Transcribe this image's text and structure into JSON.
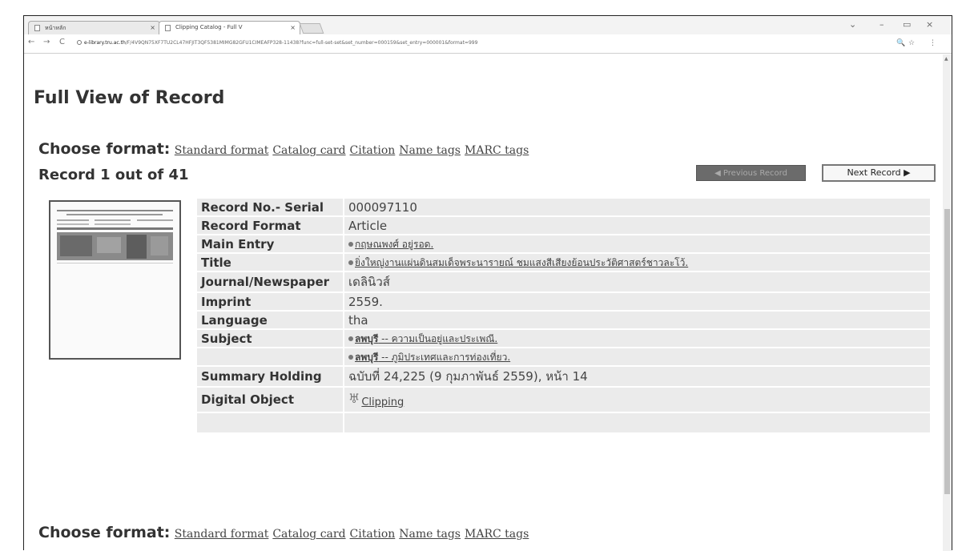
{
  "browser": {
    "tabs": [
      {
        "label": "หน้าหลัก",
        "close": "×"
      },
      {
        "label": "Clipping Catalog - Full V",
        "close": "×"
      }
    ],
    "window_controls": [
      "⌄",
      "–",
      "▭",
      "×"
    ],
    "nav": {
      "back": "←",
      "forward": "→",
      "reload": "C"
    },
    "url_host": "e-library.tru.ac.th",
    "url_path": "/F/4V9QN75XF7TU2CL47HFJIT3QF5381MIMG82GFU1CIMEAFP328-11438?func=full-set-set&set_number=000159&set_entry=000001&format=999",
    "addr_icons": [
      "🔍",
      "☆",
      "⋮"
    ]
  },
  "page": {
    "title": "Full View of Record",
    "choose_format_label": "Choose format:",
    "formats": [
      "Standard format",
      "Catalog card",
      "Citation",
      "Name tags",
      "MARC tags"
    ],
    "record_count": "Record 1 out of 41",
    "prev_button": "◀ Previous Record",
    "next_button": "Next Record ▶"
  },
  "record": [
    {
      "label": "Record No.- Serial",
      "value": "000097110"
    },
    {
      "label": "Record Format",
      "value": "Article"
    },
    {
      "label": "Main Entry",
      "value": "กฤษณพงศ์ อยู่รอด."
    },
    {
      "label": "Title",
      "value": "ยิ่งใหญ่งานแผ่นดินสมเด็จพระนารายณ์ ชมแสงสีเสียงย้อนประวัติศาสตร์ชาวละโว้."
    },
    {
      "label": "Journal/Newspaper",
      "value": "เดลินิวส์"
    },
    {
      "label": "Imprint",
      "value": "2559."
    },
    {
      "label": "Language",
      "value": "tha"
    },
    {
      "label": "Subject",
      "value_link": "ลพบุรี",
      "value_rest": " -- ความเป็นอยู่และประเพณี."
    },
    {
      "label": "",
      "value_link": "ลพบุรี",
      "value_rest": " -- ภูมิประเทศและการท่องเที่ยว."
    },
    {
      "label": "Summary Holding",
      "value": "ฉบับที่ 24,225 (9 กุมภาพันธ์ 2559), หน้า 14"
    },
    {
      "label": "Digital Object",
      "value": "Clipping"
    },
    {
      "label": "",
      "value": ""
    }
  ]
}
